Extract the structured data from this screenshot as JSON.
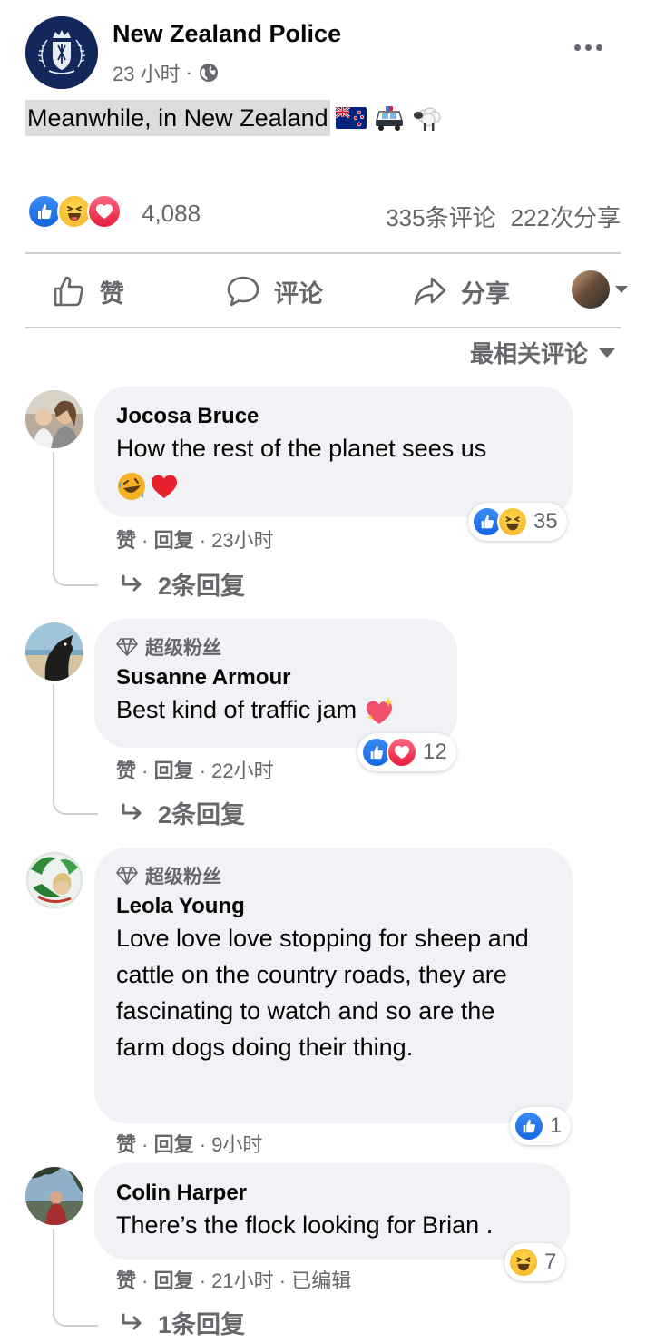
{
  "post": {
    "page_name": "New Zealand Police",
    "time": "23 小时",
    "dot": "·",
    "text": "Meanwhile, in New Zealand",
    "emoji": [
      "nz-flag-icon",
      "police-car-icon",
      "sheep-icon"
    ],
    "reactions": [
      "like",
      "haha",
      "love"
    ],
    "reaction_count": "4,088",
    "comments_count": "335条评论",
    "shares_count": "222次分享"
  },
  "actions": {
    "like": "赞",
    "comment": "评论",
    "share": "分享"
  },
  "sort_label": "最相关评论",
  "comments": [
    {
      "badge": "",
      "name": "Jocosa Bruce",
      "text": "How the rest of the planet sees us",
      "reactions": [
        "like",
        "haha"
      ],
      "reaction_count": "35",
      "like": "赞",
      "reply": "回复",
      "time": "23小时",
      "replies": "2条回复"
    },
    {
      "badge": "超级粉丝",
      "name": "Susanne Armour",
      "text": "Best kind of traffic jam",
      "reactions": [
        "like",
        "love"
      ],
      "reaction_count": "12",
      "like": "赞",
      "reply": "回复",
      "time": "22小时",
      "replies": "2条回复"
    },
    {
      "badge": "超级粉丝",
      "name": "Leola Young",
      "text": "Love love love stopping for sheep and cattle on the country roads, they are fascinating to watch and so are the farm dogs doing their thing.",
      "reactions": [
        "like"
      ],
      "reaction_count": "1",
      "like": "赞",
      "reply": "回复",
      "time": "9小时",
      "replies": ""
    },
    {
      "badge": "",
      "name": "Colin Harper",
      "text": "There’s the flock looking for Brian .",
      "reactions": [
        "haha"
      ],
      "reaction_count": "7",
      "like": "赞",
      "reply": "回复",
      "time": "21小时",
      "edited": "已编辑",
      "replies": "1条回复"
    }
  ],
  "colors": {
    "text": "#050505",
    "secondary": "#65676b",
    "bubble": "#f0f2f5",
    "divider": "#ced0d4",
    "like": "#1877f2",
    "love": "#f33e58",
    "haha": "#f7b125",
    "police_navy": "#14275a"
  }
}
